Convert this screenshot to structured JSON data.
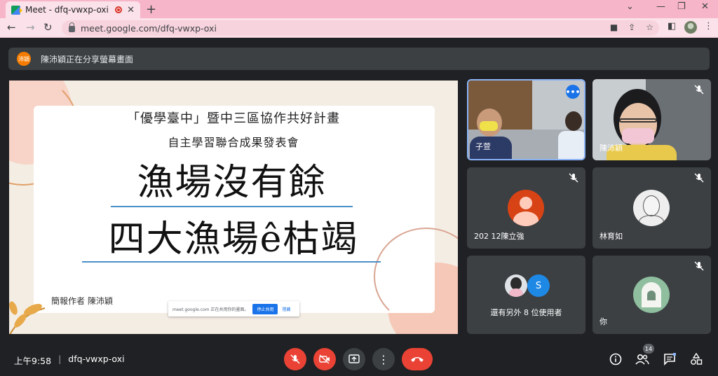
{
  "browser": {
    "tab_title": "Meet - dfq-vwxp-oxi",
    "tab_close": "✕",
    "new_tab": "+",
    "url": "meet.google.com/dfq-vwxp-oxi",
    "theme_color": "#f6b5c8",
    "window_controls": {
      "minimize": "⌄",
      "min": "—",
      "restore": "❐",
      "close": "✕"
    }
  },
  "banner": {
    "avatar_text": "沛穎",
    "text": "陳沛穎正在分享螢幕畫面"
  },
  "slide": {
    "subtitle1": "「優學臺中」暨中三區協作共好計畫",
    "subtitle2": "自主學習聯合成果發表會",
    "title1": "漁場沒有餘",
    "title2": "四大漁場ê枯竭",
    "author": "簡報作者 陳沛穎",
    "share_text": "meet.google.com 正在共用你的畫面。",
    "stop_label": "停止共用",
    "hide_label": "隱藏"
  },
  "participants": [
    {
      "name": "子萱",
      "type": "video"
    },
    {
      "name": "陳沛穎",
      "type": "video"
    },
    {
      "name": "202 12陳立強",
      "type": "avatar",
      "avatar_color": "#d84315"
    },
    {
      "name": "林育如",
      "type": "avatar"
    },
    {
      "name": "還有另外 8 位使用者",
      "type": "others",
      "avatar_letter": "S",
      "avatar_color": "#1e88e5"
    },
    {
      "name": "你",
      "type": "avatar"
    }
  ],
  "bottom": {
    "time": "上午9:58",
    "meeting_code": "dfq-vwxp-oxi",
    "participant_count": "14"
  }
}
